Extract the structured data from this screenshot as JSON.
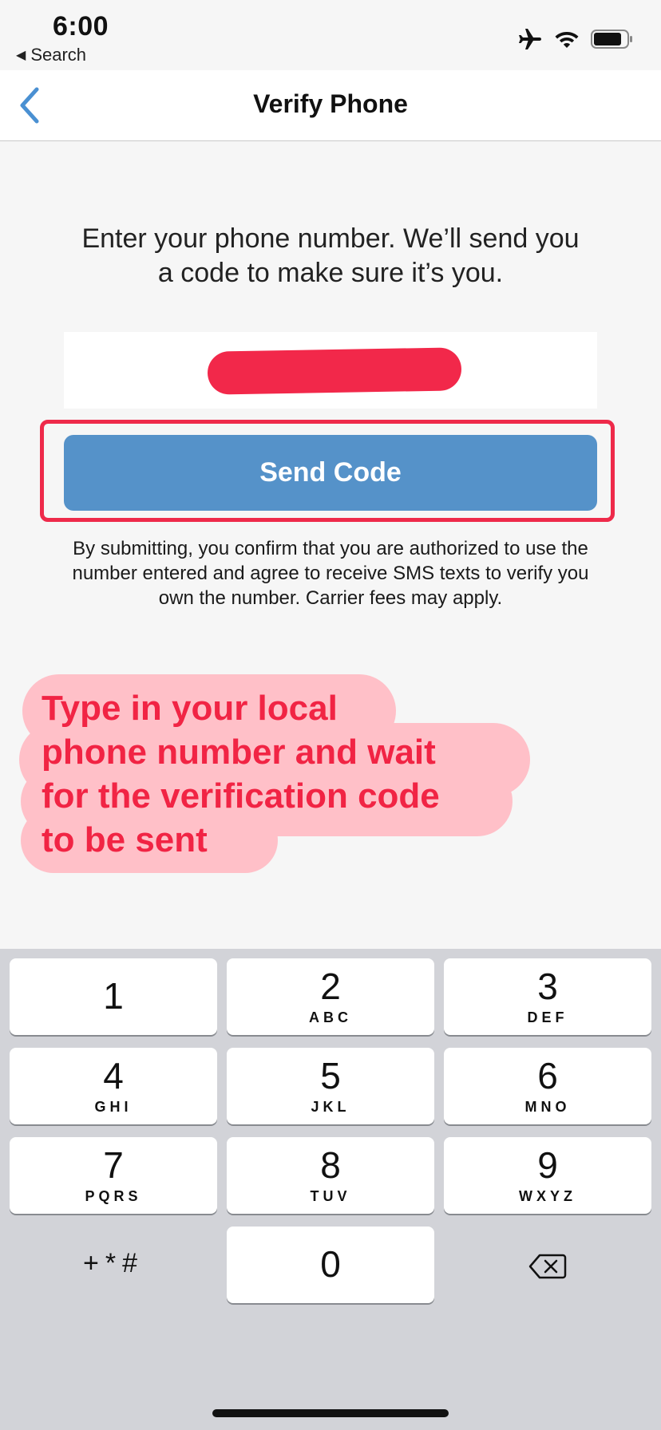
{
  "status_bar": {
    "time": "6:00",
    "back_to_app": "Search",
    "icons": [
      "airplane-icon",
      "wifi-icon",
      "battery-icon"
    ]
  },
  "nav": {
    "title": "Verify Phone",
    "back_icon": "chevron-left-icon"
  },
  "content": {
    "instruction_line1": "Enter your phone number. We’ll send you",
    "instruction_line2": "a code to make sure it’s you.",
    "send_button_label": "Send Code",
    "disclaimer": "By submitting, you confirm that you are authorized to use the number entered and agree to receive SMS texts to verify you own the number. Carrier fees may apply."
  },
  "annotation": {
    "line1": "Type in your local",
    "line2": "phone number and wait",
    "line3": "for the verification code",
    "line4": "to be sent"
  },
  "keypad": {
    "keys": [
      {
        "num": "1",
        "letters": ""
      },
      {
        "num": "2",
        "letters": "ABC"
      },
      {
        "num": "3",
        "letters": "DEF"
      },
      {
        "num": "4",
        "letters": "GHI"
      },
      {
        "num": "5",
        "letters": "JKL"
      },
      {
        "num": "6",
        "letters": "MNO"
      },
      {
        "num": "7",
        "letters": "PQRS"
      },
      {
        "num": "8",
        "letters": "TUV"
      },
      {
        "num": "9",
        "letters": "WXYZ"
      },
      {
        "num": "0",
        "letters": ""
      }
    ],
    "symbols": "+*#",
    "delete_icon": "backspace-icon"
  },
  "colors": {
    "accent_blue": "#5592c9",
    "annotation_red": "#f12444",
    "annotation_bg": "#ffc0c8",
    "keypad_bg": "#d2d3d8"
  }
}
